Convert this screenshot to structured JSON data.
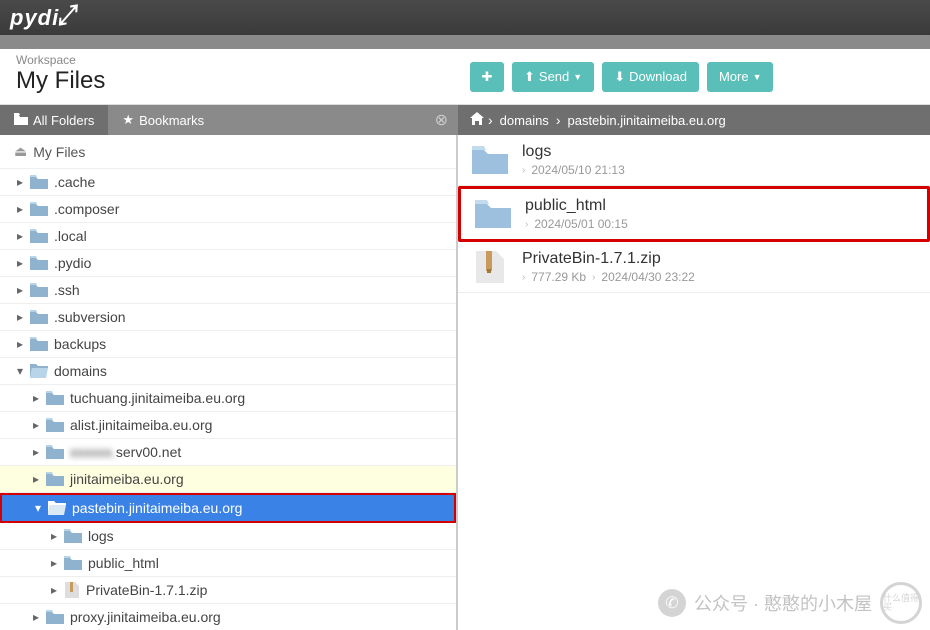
{
  "brand": "pydi",
  "workspace": {
    "label": "Workspace",
    "title": "My Files"
  },
  "toolbar": {
    "send": "Send",
    "download": "Download",
    "more": "More"
  },
  "tabs": {
    "all_folders": "All Folders",
    "bookmarks": "Bookmarks"
  },
  "breadcrumb": {
    "seg1": "domains",
    "seg2": "pastebin.jinitaimeiba.eu.org"
  },
  "tree": {
    "root": "My Files",
    "nodes": [
      {
        "name": ".cache"
      },
      {
        "name": ".composer"
      },
      {
        "name": ".local"
      },
      {
        "name": ".pydio"
      },
      {
        "name": ".ssh"
      },
      {
        "name": ".subversion"
      },
      {
        "name": "backups"
      },
      {
        "name": "domains"
      }
    ],
    "domains_children": [
      {
        "name": "tuchuang.jinitaimeiba.eu.org"
      },
      {
        "name": "alist.jinitaimeiba.eu.org"
      },
      {
        "name": "serv00.net",
        "blurred_prefix": "[blurred]"
      },
      {
        "name": "jinitaimeiba.eu.org"
      },
      {
        "name": "pastebin.jinitaimeiba.eu.org"
      }
    ],
    "pastebin_children": [
      {
        "name": "logs",
        "type": "folder"
      },
      {
        "name": "public_html",
        "type": "folder"
      },
      {
        "name": "PrivateBin-1.7.1.zip",
        "type": "file"
      }
    ],
    "last_node": "proxy.jinitaimeiba.eu.org"
  },
  "content": [
    {
      "name": "logs",
      "type": "folder",
      "date": "2024/05/10 21:13"
    },
    {
      "name": "public_html",
      "type": "folder",
      "date": "2024/05/01 00:15",
      "highlighted": true
    },
    {
      "name": "PrivateBin-1.7.1.zip",
      "type": "file",
      "size": "777.29 Kb",
      "date": "2024/04/30 23:22"
    }
  ],
  "watermark": {
    "text": "公众号 · 憨憨的小木屋",
    "badge": "什么值得买"
  }
}
